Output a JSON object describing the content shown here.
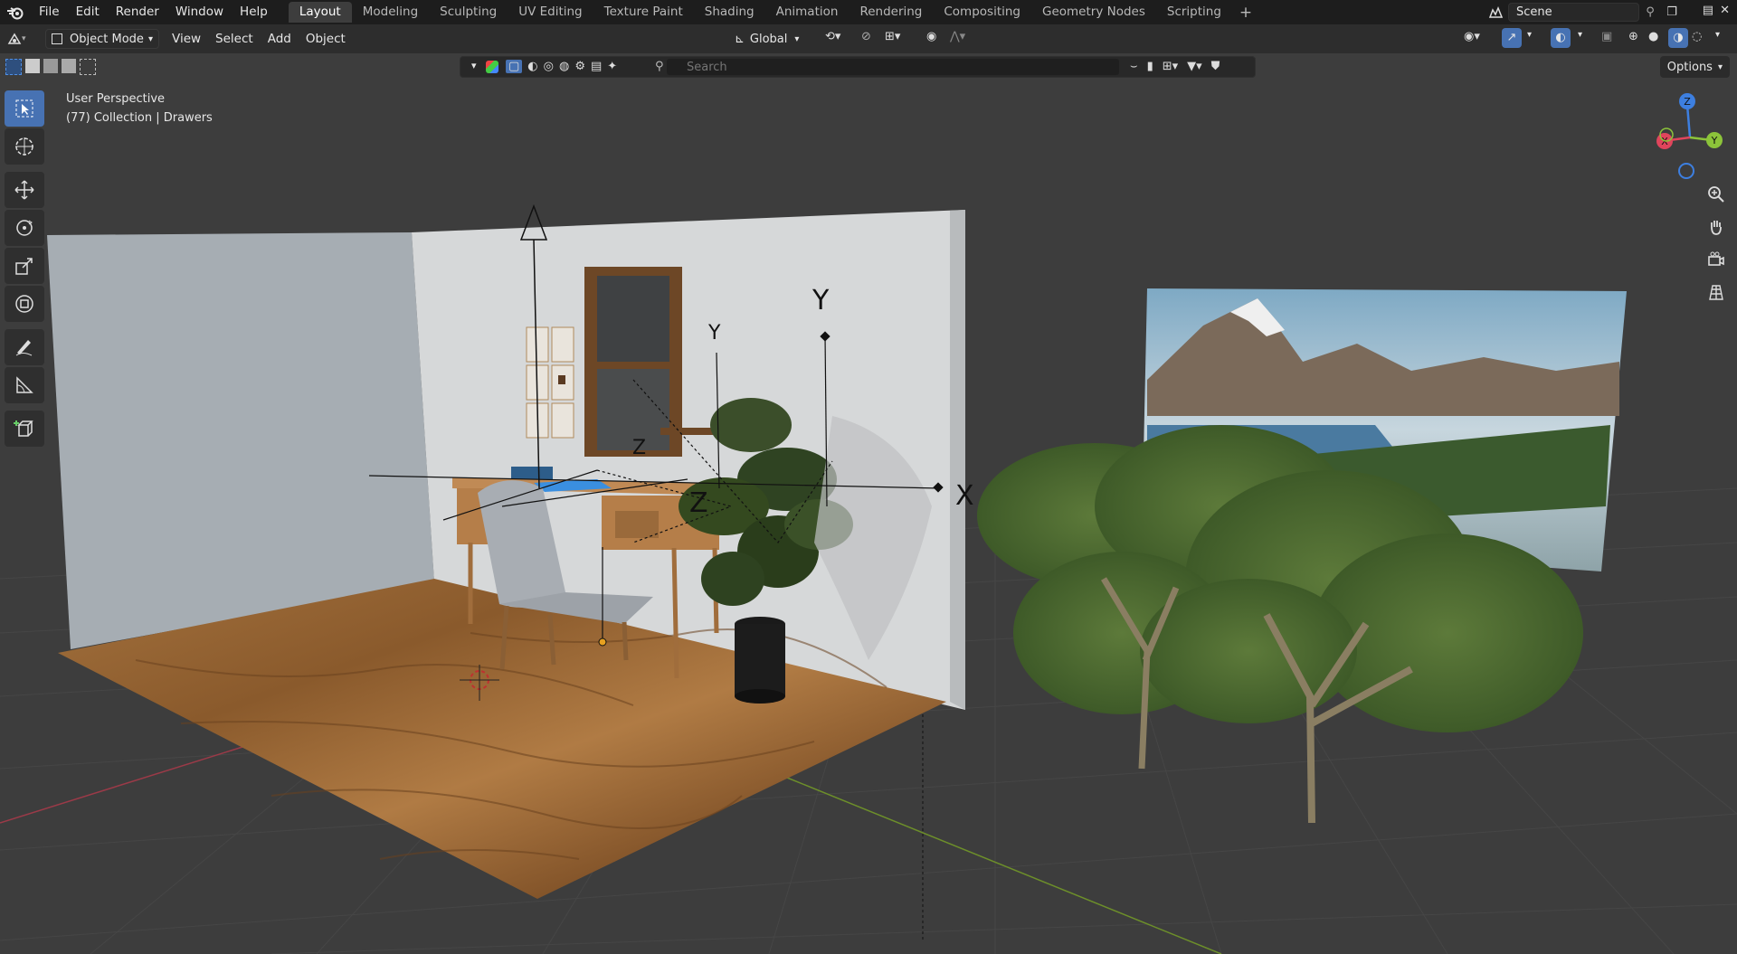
{
  "menu": {
    "file": "File",
    "edit": "Edit",
    "render": "Render",
    "window": "Window",
    "help": "Help"
  },
  "workspaces": [
    "Layout",
    "Modeling",
    "Sculpting",
    "UV Editing",
    "Texture Paint",
    "Shading",
    "Animation",
    "Rendering",
    "Compositing",
    "Geometry Nodes",
    "Scripting"
  ],
  "active_workspace": "Layout",
  "scene": {
    "name": "Scene"
  },
  "header": {
    "mode": "Object Mode",
    "view": "View",
    "select": "Select",
    "add": "Add",
    "object": "Object",
    "orientation": "Global"
  },
  "search": {
    "placeholder": "Search"
  },
  "options_label": "Options",
  "viewport": {
    "perspective": "User Perspective",
    "collection": "(77) Collection | Drawers"
  },
  "gizmo": {
    "x": "X",
    "y": "Y",
    "z": "Z"
  },
  "empty_labels": {
    "y1": "Y",
    "y2": "Y",
    "z1": "Z",
    "z2": "Z",
    "x1": "X"
  },
  "colors": {
    "accent": "#4772b3",
    "axis_x": "#e0455c",
    "axis_y": "#8cc43a",
    "axis_z": "#3d7fe0",
    "bg": "#3d3d3d"
  }
}
